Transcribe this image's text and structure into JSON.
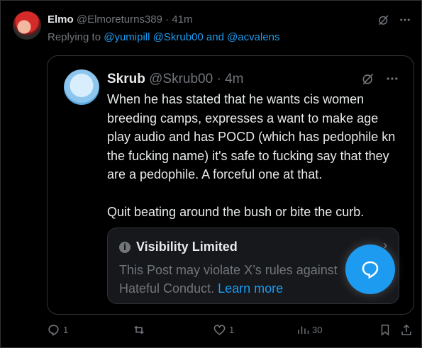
{
  "post": {
    "author_name": "Elmo",
    "author_handle": "@Elmoreturns389",
    "separator": "·",
    "time": "41m",
    "replying_prefix": "Replying to",
    "replying_handles": "@yumipill @Skrub00 and @acvalens"
  },
  "quote": {
    "author_name": "Skrub",
    "author_handle": "@Skrub00",
    "separator": "·",
    "time": "4m",
    "paragraph_1": "When he has stated that he wants cis women breeding camps, expresses a want to make age play audio and has POCD (which has pedophile kn the fucking name) it's safe to fucking say that they are a pedophile. A forceful one at that.",
    "paragraph_2": "Quit beating around the bush or bite the curb."
  },
  "visibility": {
    "title": "Visibility Limited",
    "text": "This Post may violate X’s rules against Hateful Conduct.",
    "link": "Learn more"
  },
  "actions": {
    "replies": "1",
    "likes": "1",
    "views": "30"
  },
  "colors": {
    "background": "#000000",
    "accent": "#1d9bf0",
    "muted": "#71767b",
    "text": "#e7e9ea"
  },
  "icons": [
    "grok-icon",
    "more-icon",
    "reply-icon",
    "repost-icon",
    "like-icon",
    "views-icon",
    "bookmark-icon",
    "share-icon",
    "info-icon",
    "chat-bubble-icon"
  ]
}
